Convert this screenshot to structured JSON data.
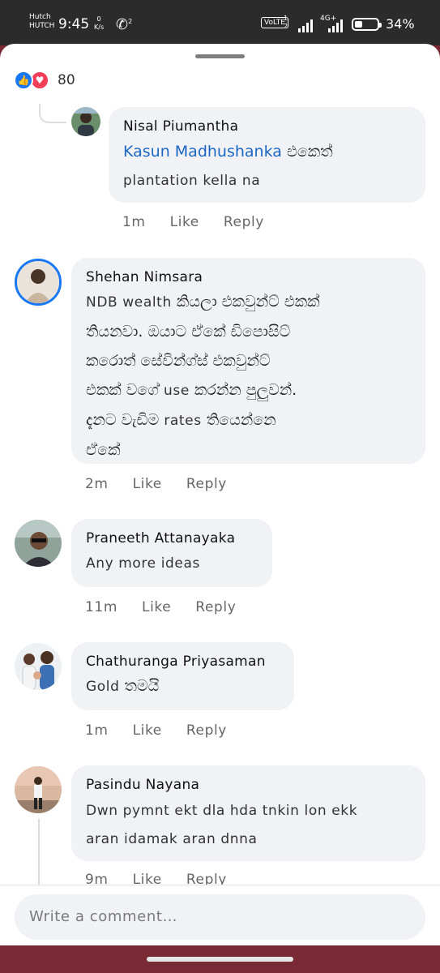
{
  "status_bar": {
    "carrier_top": "Hutch",
    "carrier_bottom": "HUTCH",
    "time": "9:45",
    "speed_value": "0",
    "speed_unit": "K/s",
    "call_sup": "2",
    "volte": "VoLTE",
    "sim_top": "1",
    "sim_bottom": "2",
    "network": "4G+",
    "battery_level": 0.34,
    "battery_text": "34%"
  },
  "reactions": {
    "count": "80",
    "like_icon": "like-icon",
    "love_icon": "love-icon"
  },
  "comments": [
    {
      "author": "Nisal Piumantha",
      "mention": "Kasun Madhushanka",
      "text_after_mention": " එකෙත්",
      "text_line2": "plantation kella na",
      "time": "1m",
      "like": "Like",
      "reply": "Reply"
    },
    {
      "author": "Shehan Nimsara",
      "lines": [
        [
          "NDB wealth",
          " කියලා එකවුන්ට් එකක්"
        ],
        [
          "",
          "තියනවා. ඔයාට ඒකේ ඩිපොසිට්"
        ],
        [
          "",
          "කරොත් සේවින්ග්ස් එකවුන්ට්"
        ],
        [
          "",
          "එකක් වගේ ",
          "use",
          " කරන්න පුලුවන්."
        ],
        [
          "",
          "දැනට වැඩිම  ",
          "rates",
          " තියෙන්නෙ"
        ],
        [
          "",
          "ඒකේ"
        ]
      ],
      "time": "2m",
      "like": "Like",
      "reply": "Reply"
    },
    {
      "author": "Praneeth Attanayaka",
      "text": "Any more ideas",
      "time": "11m",
      "like": "Like",
      "reply": "Reply"
    },
    {
      "author": "Chathuranga Priyasaman",
      "text_latin": "Gold",
      "text_sinhala": " තමයි",
      "time": "1m",
      "like": "Like",
      "reply": "Reply"
    },
    {
      "author": "Pasindu Nayana",
      "text_line1": "Dwn pymnt ekt dla hda tnkin lon ekk",
      "text_line2": "aran idamak aran dnna",
      "time": "9m",
      "like": "Like",
      "reply": "Reply"
    }
  ],
  "composer": {
    "placeholder": "Write a comment…"
  }
}
